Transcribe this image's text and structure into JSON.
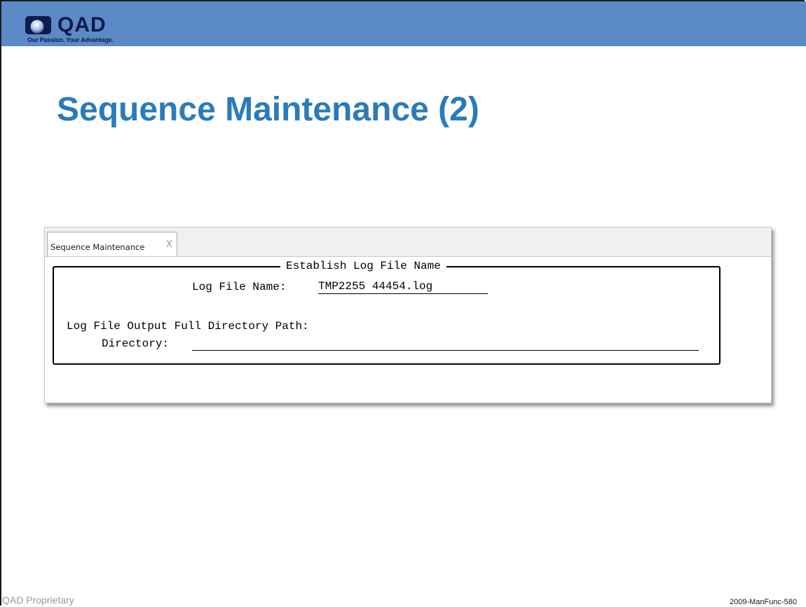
{
  "header": {
    "brand_name": "QAD",
    "tagline": "Our Passion. Your Advantage.",
    "bar_color": "#5b8ac6"
  },
  "slide": {
    "title": "Sequence Maintenance (2)",
    "title_color": "#2b7bb9"
  },
  "app": {
    "tab_label": "Sequence Maintenance",
    "tab_close_glyph": "X",
    "dialog": {
      "title": "Establish Log File Name",
      "log_file_name_label": "Log File Name:",
      "log_file_name_value": "TMP2255 44454.log",
      "output_path_heading": "Log File Output Full Directory Path:",
      "directory_label": "Directory:",
      "directory_value": ""
    }
  },
  "footer": {
    "left_text": "QAD Proprietary",
    "right_text": "2009-ManFunc-580"
  }
}
